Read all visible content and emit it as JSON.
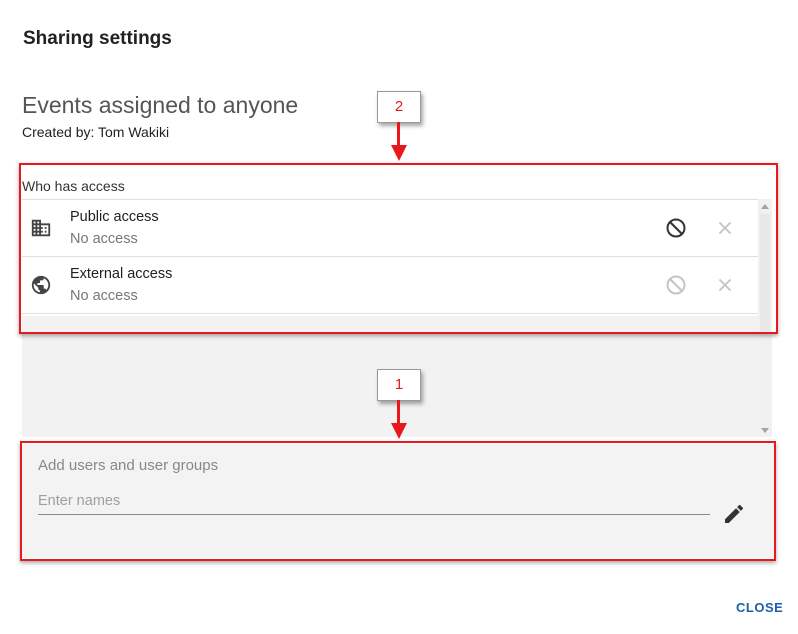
{
  "dialog": {
    "title": "Sharing settings",
    "object_name": "Events assigned to anyone",
    "created_by": "Created by: Tom Wakiki",
    "close_label": "CLOSE"
  },
  "access": {
    "header": "Who has access",
    "rows": [
      {
        "icon": "building-icon",
        "title": "Public access",
        "subtitle": "No access",
        "deny_icon": "block-icon",
        "remove_icon": "close-icon"
      },
      {
        "icon": "globe-icon",
        "title": "External access",
        "subtitle": "No access",
        "deny_icon": "block-icon",
        "remove_icon": "close-icon"
      }
    ]
  },
  "add_users": {
    "label": "Add users and user groups",
    "placeholder": "Enter names",
    "value": "",
    "edit_icon": "pencil-icon"
  },
  "annotations": [
    {
      "label": "2",
      "color": "#e8191e"
    },
    {
      "label": "1",
      "color": "#e8191e"
    }
  ],
  "colors": {
    "annotation": "#e8191e",
    "close_button": "#1f5fa8",
    "add_section_bg": "#f3f3f3"
  }
}
